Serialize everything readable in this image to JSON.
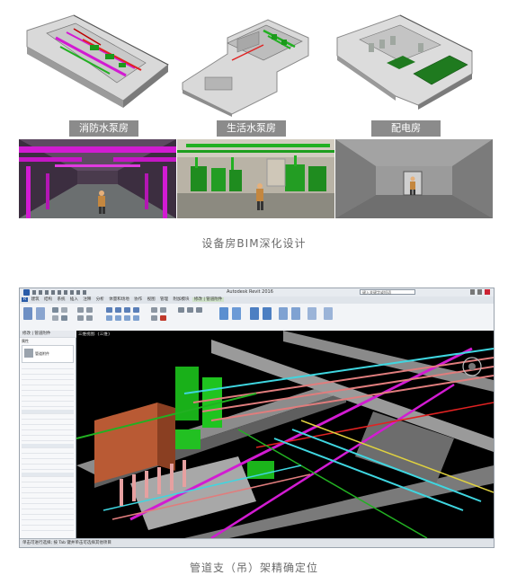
{
  "panel_top": {
    "labels": [
      "消防水泵房",
      "生活水泵房",
      "配电房"
    ],
    "caption": "设备房BIM深化设计"
  },
  "panel_bottom": {
    "caption": "管道支（吊）架精确定位",
    "software": {
      "title": "Autodesk Revit 2016",
      "search_placeholder": "键入关键字或短语",
      "tabs": [
        "建筑",
        "结构",
        "系统",
        "插入",
        "注释",
        "分析",
        "体量和场地",
        "协作",
        "视图",
        "管理",
        "附加模块",
        "修改 | 管道附件"
      ],
      "option_bar": "修改 | 管道附件",
      "view_selector": "三维视图: {三维}",
      "properties_title": "属性",
      "properties_type": "管道附件",
      "status_text": "单击可进行选择; 按 Tab 键并单击可选择其他项目"
    }
  },
  "colors": {
    "caption_bg": "#8b8b8b",
    "pipe_magenta": "#d21bd2",
    "pipe_green": "#22b022",
    "duct_orange": "#c8643c",
    "pipe_cyan": "#3fd6e0",
    "pipe_red": "#e02222"
  }
}
